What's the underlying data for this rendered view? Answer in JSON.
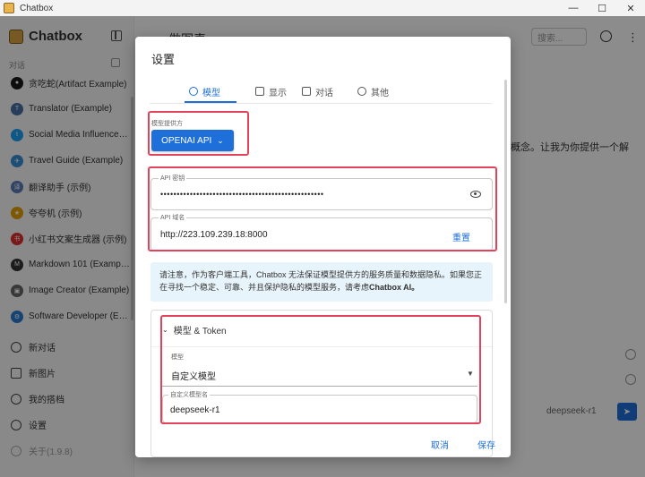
{
  "window": {
    "title": "Chatbox",
    "minimize": "—",
    "maximize": "☐",
    "close": "✕"
  },
  "sidebar": {
    "brand": "Chatbox",
    "section_label": "对话",
    "conversations": [
      {
        "label": "贪吃蛇(Artifact Example)",
        "color": "#1a1a1a",
        "glyph": "●"
      },
      {
        "label": "Translator (Example)",
        "color": "#4a6fa5",
        "glyph": "T"
      },
      {
        "label": "Social Media Influence…",
        "color": "#1da1f2",
        "glyph": "t"
      },
      {
        "label": "Travel Guide (Example)",
        "color": "#3a8fd6",
        "glyph": "✈"
      },
      {
        "label": "翻译助手 (示例)",
        "color": "#5a7db8",
        "glyph": "译"
      },
      {
        "label": "夸夸机 (示例)",
        "color": "#e5a100",
        "glyph": "★"
      },
      {
        "label": "小红书文案生成器 (示例)",
        "color": "#e02e2e",
        "glyph": "书"
      },
      {
        "label": "Markdown 101 (Examp…",
        "color": "#333333",
        "glyph": "M"
      },
      {
        "label": "Image Creator (Example)",
        "color": "#666666",
        "glyph": "▣"
      },
      {
        "label": "Software Developer (E…",
        "color": "#2b7ad1",
        "glyph": "⚙"
      }
    ],
    "actions": [
      {
        "label": "新对话"
      },
      {
        "label": "新图片"
      },
      {
        "label": "我的搭档"
      },
      {
        "label": "设置"
      },
      {
        "label": "关于(1.9.8)"
      }
    ]
  },
  "main": {
    "title": "做图表",
    "search_placeholder": "搜索...",
    "text_fragment": "概念。让我为你提供一个解",
    "model_label": "deepseek-r1",
    "send_icon": "➤"
  },
  "dialog": {
    "title": "设置",
    "tabs": [
      {
        "label": "模型",
        "active": true
      },
      {
        "label": "显示",
        "active": false
      },
      {
        "label": "对话",
        "active": false
      },
      {
        "label": "其他",
        "active": false
      }
    ],
    "provider_label": "模型提供方",
    "provider_value": "OPENAI API",
    "api_key_label": "API 密钥",
    "api_key_value": "••••••••••••••••••••••••••••••••••••••••••••••••••",
    "api_host_label": "API 域名",
    "api_host_value": "http://223.109.239.18:8000",
    "reset_label": "重置",
    "notice_text": "请注意，作为客户端工具，Chatbox 无法保证模型提供方的服务质量和数据隐私。如果您正在寻找一个稳定、可靠、并且保护隐私的模型服务，请考虑",
    "notice_bold": "Chatbox AI。",
    "accordion_title": "模型 & Token",
    "model_label": "模型",
    "model_value": "自定义模型",
    "custom_model_label": "自定义模型名",
    "custom_model_value": "deepseek-r1",
    "cancel_label": "取消",
    "save_label": "保存"
  },
  "colors": {
    "accent": "#1e6fd9",
    "highlight": "#e0435a",
    "notice_bg": "#e8f4fb"
  }
}
